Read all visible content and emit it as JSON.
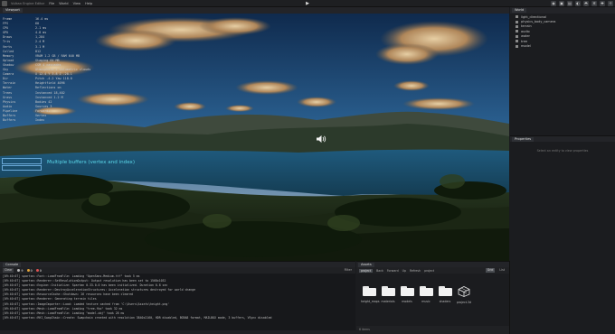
{
  "menubar": {
    "title": "Vulkan Engine Editor",
    "menus": [
      "File",
      "World",
      "View",
      "Help"
    ],
    "play_icon": "play-icon",
    "toolbar_icons": [
      "camera-icon",
      "image-icon",
      "image-icon",
      "light-icon",
      "lamp-icon",
      "gear-icon",
      "puzzle-icon",
      "sun-icon"
    ]
  },
  "viewport": {
    "tab_label": "Viewport",
    "tooltip": "Multiple buffers (vertex and index)",
    "speaker_icon": "speaker-icon",
    "stats": [
      {
        "k": "Frame",
        "v": "16.4 ms"
      },
      {
        "k": "FPS",
        "v": "60"
      },
      {
        "k": "CPU",
        "v": "2.1 ms"
      },
      {
        "k": "GPU",
        "v": "4.8 ms"
      },
      {
        "k": "Draws",
        "v": "1,284"
      },
      {
        "k": "Tris",
        "v": "2.4 M"
      },
      {
        "k": "Verts",
        "v": "3.1 M"
      },
      {
        "k": "Culled",
        "v": "812"
      },
      {
        "k": "Memory",
        "v": "VRAM 1.2 GB / RAM 640 MB"
      },
      {
        "k": "Upload",
        "v": "Staging 64 MB"
      },
      {
        "k": "Shadow",
        "v": "CSM 4 cascades"
      },
      {
        "k": "Sky",
        "v": "Atmosphere + volumetric clouds"
      },
      {
        "k": "Camera",
        "v": "X 12.4  Y 3.8  Z -20.1"
      },
      {
        "k": "Dir",
        "v": "Pitch -4.2  Yaw 118.0"
      },
      {
        "k": "Terrain",
        "v": "Heightfield 4096"
      },
      {
        "k": "Water",
        "v": "Reflections on"
      },
      {
        "k": "Trees",
        "v": "Instanced 18,402"
      },
      {
        "k": "Grass",
        "v": "Instanced 1.2 M"
      },
      {
        "k": "Physics",
        "v": "Bodies 42"
      },
      {
        "k": "Audio",
        "v": "Sources 3"
      },
      {
        "k": "Pipeline",
        "v": "Forward+"
      },
      {
        "k": "Buffers",
        "v": "Vertex"
      },
      {
        "k": "Buffers",
        "v": "Index"
      }
    ]
  },
  "world": {
    "tab_label": "World",
    "items": [
      "light_directional",
      "physics_body_camera",
      "terrain",
      "audio",
      "water",
      "tree",
      "model"
    ]
  },
  "properties": {
    "tab_label": "Properties",
    "hint": "Select an entity to view properties"
  },
  "console": {
    "tab_label": "Console",
    "clear_label": "Clear",
    "counts": [
      {
        "color": "#bbbbbb",
        "n": "9"
      },
      {
        "color": "#e0a33a",
        "n": "0"
      },
      {
        "color": "#e05252",
        "n": "0"
      }
    ],
    "filter_label": "Filter",
    "lines": [
      "[09:40:07] spartan::Font::LoadFromFile: Loading \"OpenSans-Medium.ttf\" took 5 ms",
      "[09:40:07] spartan::Renderer::SetResolutionOutput: Output resolution has been set to 1568x1032",
      "[09:40:07] spartan::Engine::Initialize: Spartan 0.33.0.0 has been initialized. Duration 0.8 sec",
      "[09:40:07] spartan::Renderer::DestroyAccelerationStructures: Acceleration structures destroyed for world change",
      "[09:40:07] spartan::ResourceCache::Shutdown: 26 resources have been cleared",
      "[09:40:07] spartan::Renderer: Generating terrain tiles",
      "[09:40:07] spartan::ImageImporter::Load: Loaded texture cached from 'C:\\Users\\Assets\\height.png'",
      "[09:40:07] spartan::Mesh::LoadFromFile: Loading \"tree.fbx\" took 32 ms",
      "[09:40:07] spartan::Mesh::LoadFromFile: Loading \"model.obj\" took 28 ms",
      "[09:40:07] spartan::RHI_SwapChain::Create: Swapchain created with resolution 3840x2160, HDR disabled, BGRA8 format, MAILBOX mode, 3 buffers, VSync disabled"
    ]
  },
  "assets": {
    "tab_label": "Assets",
    "import_label": "Import",
    "nav": [
      "project",
      "Back",
      "Forward",
      "Up",
      "Refresh"
    ],
    "path": "project",
    "view_modes": [
      "Grid",
      "List"
    ],
    "items": [
      {
        "label": "height_maps",
        "kind": "folder"
      },
      {
        "label": "materials",
        "kind": "folder"
      },
      {
        "label": "models",
        "kind": "folder"
      },
      {
        "label": "music",
        "kind": "folder"
      },
      {
        "label": "shaders",
        "kind": "folder"
      },
      {
        "label": "project.3d",
        "kind": "file"
      }
    ],
    "status": "6 items"
  }
}
